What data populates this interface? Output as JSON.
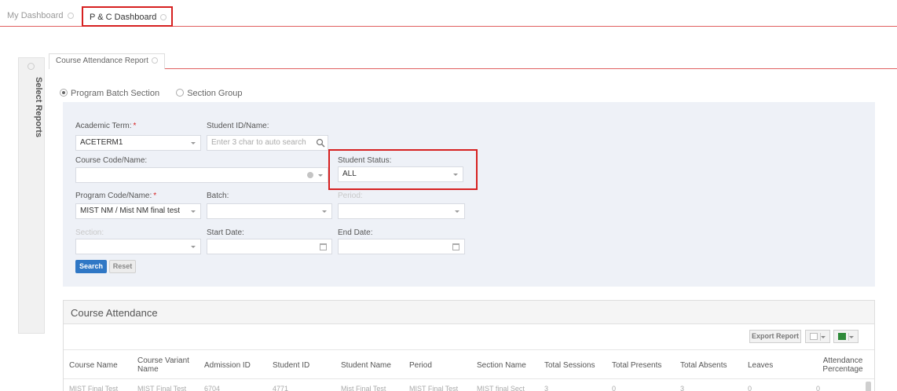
{
  "top_tabs": [
    {
      "label": "My Dashboard",
      "active": false
    },
    {
      "label": "P & C Dashboard",
      "active": true
    }
  ],
  "side_rail": {
    "label": "Select Reports"
  },
  "report_tab": {
    "label": "Course Attendance Report"
  },
  "selection_mode": {
    "options": [
      {
        "label": "Program Batch Section",
        "selected": true
      },
      {
        "label": "Section Group",
        "selected": false
      }
    ]
  },
  "filters": {
    "academic_term": {
      "label": "Academic Term:",
      "required": "*",
      "value": "ACETERM1"
    },
    "student_id": {
      "label": "Student ID/Name:",
      "placeholder": "Enter 3 char to auto search"
    },
    "course_code": {
      "label": "Course Code/Name:",
      "value": ""
    },
    "student_status": {
      "label": "Student Status:",
      "value": "ALL"
    },
    "program_code": {
      "label": "Program Code/Name:",
      "required": "*",
      "value": "MIST NM / Mist NM final test"
    },
    "batch": {
      "label": "Batch:",
      "value": ""
    },
    "period": {
      "label": "Period:",
      "value": ""
    },
    "section": {
      "label": "Section:",
      "value": ""
    },
    "start_date": {
      "label": "Start Date:",
      "value": ""
    },
    "end_date": {
      "label": "End Date:",
      "value": ""
    }
  },
  "buttons": {
    "search": "Search",
    "reset": "Reset"
  },
  "attendance": {
    "title": "Course Attendance",
    "export_label": "Export Report",
    "columns": [
      "Course Name",
      "Course Variant Name",
      "Admission ID",
      "Student ID",
      "Student Name",
      "Period",
      "Section Name",
      "Total Sessions",
      "Total Presents",
      "Total Absents",
      "Leaves",
      "Attendance Percentage"
    ],
    "rows": [
      [
        "MIST Final Test",
        "MIST Final Test",
        "6704",
        "4771",
        "Mist Final Test",
        "MIST Final Test",
        "MIST final Sect",
        "3",
        "0",
        "3",
        "0",
        "0"
      ]
    ]
  },
  "colors": {
    "accent_red": "#d62020",
    "primary_blue": "#2f77c5",
    "panel_bg": "#eef1f7"
  }
}
